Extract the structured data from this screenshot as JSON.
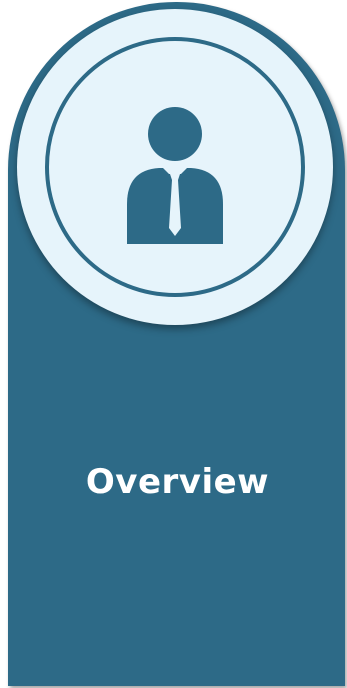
{
  "card": {
    "title": "Overview",
    "icon": "user-with-tie-icon"
  },
  "colors": {
    "card_background": "#2d6a87",
    "medallion_background": "#e6f4fb",
    "text": "#ffffff"
  }
}
